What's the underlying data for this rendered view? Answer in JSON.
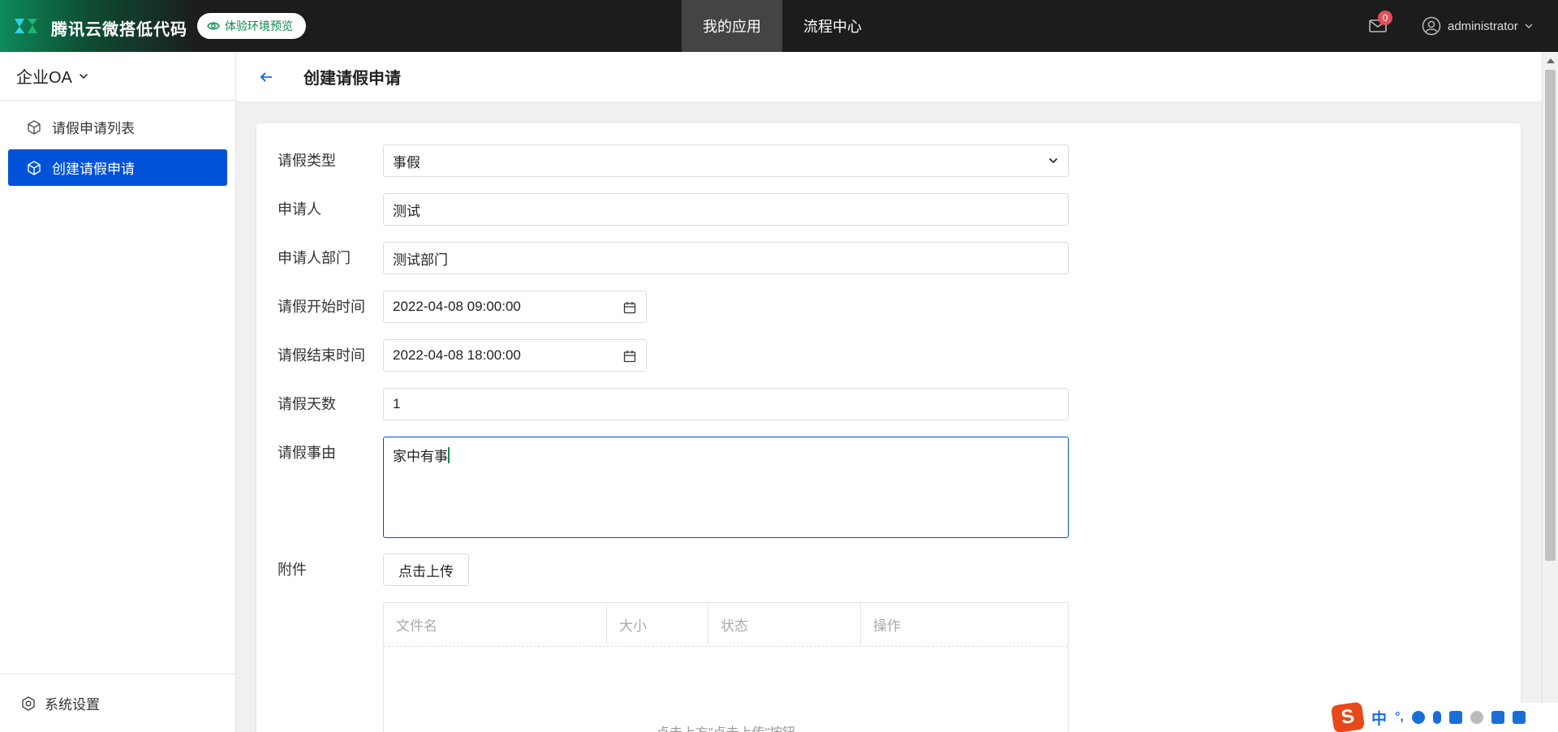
{
  "topbar": {
    "brand_title": "腾讯云微搭低代码",
    "env_label": "体验环境预览",
    "nav": [
      {
        "label": "我的应用",
        "active": true
      },
      {
        "label": "流程中心",
        "active": false
      }
    ],
    "mail_count": "0",
    "username": "administrator"
  },
  "sidebar": {
    "app_name": "企业OA",
    "items": [
      {
        "label": "请假申请列表",
        "active": false
      },
      {
        "label": "创建请假申请",
        "active": true
      }
    ],
    "settings_label": "系统设置"
  },
  "header": {
    "title": "创建请假申请"
  },
  "form": {
    "leave_type": {
      "label": "请假类型",
      "value": "事假"
    },
    "applicant": {
      "label": "申请人",
      "value": "测试"
    },
    "department": {
      "label": "申请人部门",
      "value": "测试部门"
    },
    "start_time": {
      "label": "请假开始时间",
      "value": "2022-04-08 09:00:00"
    },
    "end_time": {
      "label": "请假结束时间",
      "value": "2022-04-08 18:00:00"
    },
    "days": {
      "label": "请假天数",
      "value": "1"
    },
    "reason": {
      "label": "请假事由",
      "value": "家中有事"
    },
    "attachment": {
      "label": "附件",
      "upload_label": "点击上传",
      "columns": [
        "文件名",
        "大小",
        "状态",
        "操作"
      ],
      "empty_text": "点击上方\"点击上传\"按钮"
    }
  },
  "ime": {
    "mode": "中"
  },
  "colors": {
    "primary": "#0052d9",
    "topbar": "#1c1c1c",
    "brand_green": "#0e8a4d",
    "badge": "#e34d59"
  }
}
